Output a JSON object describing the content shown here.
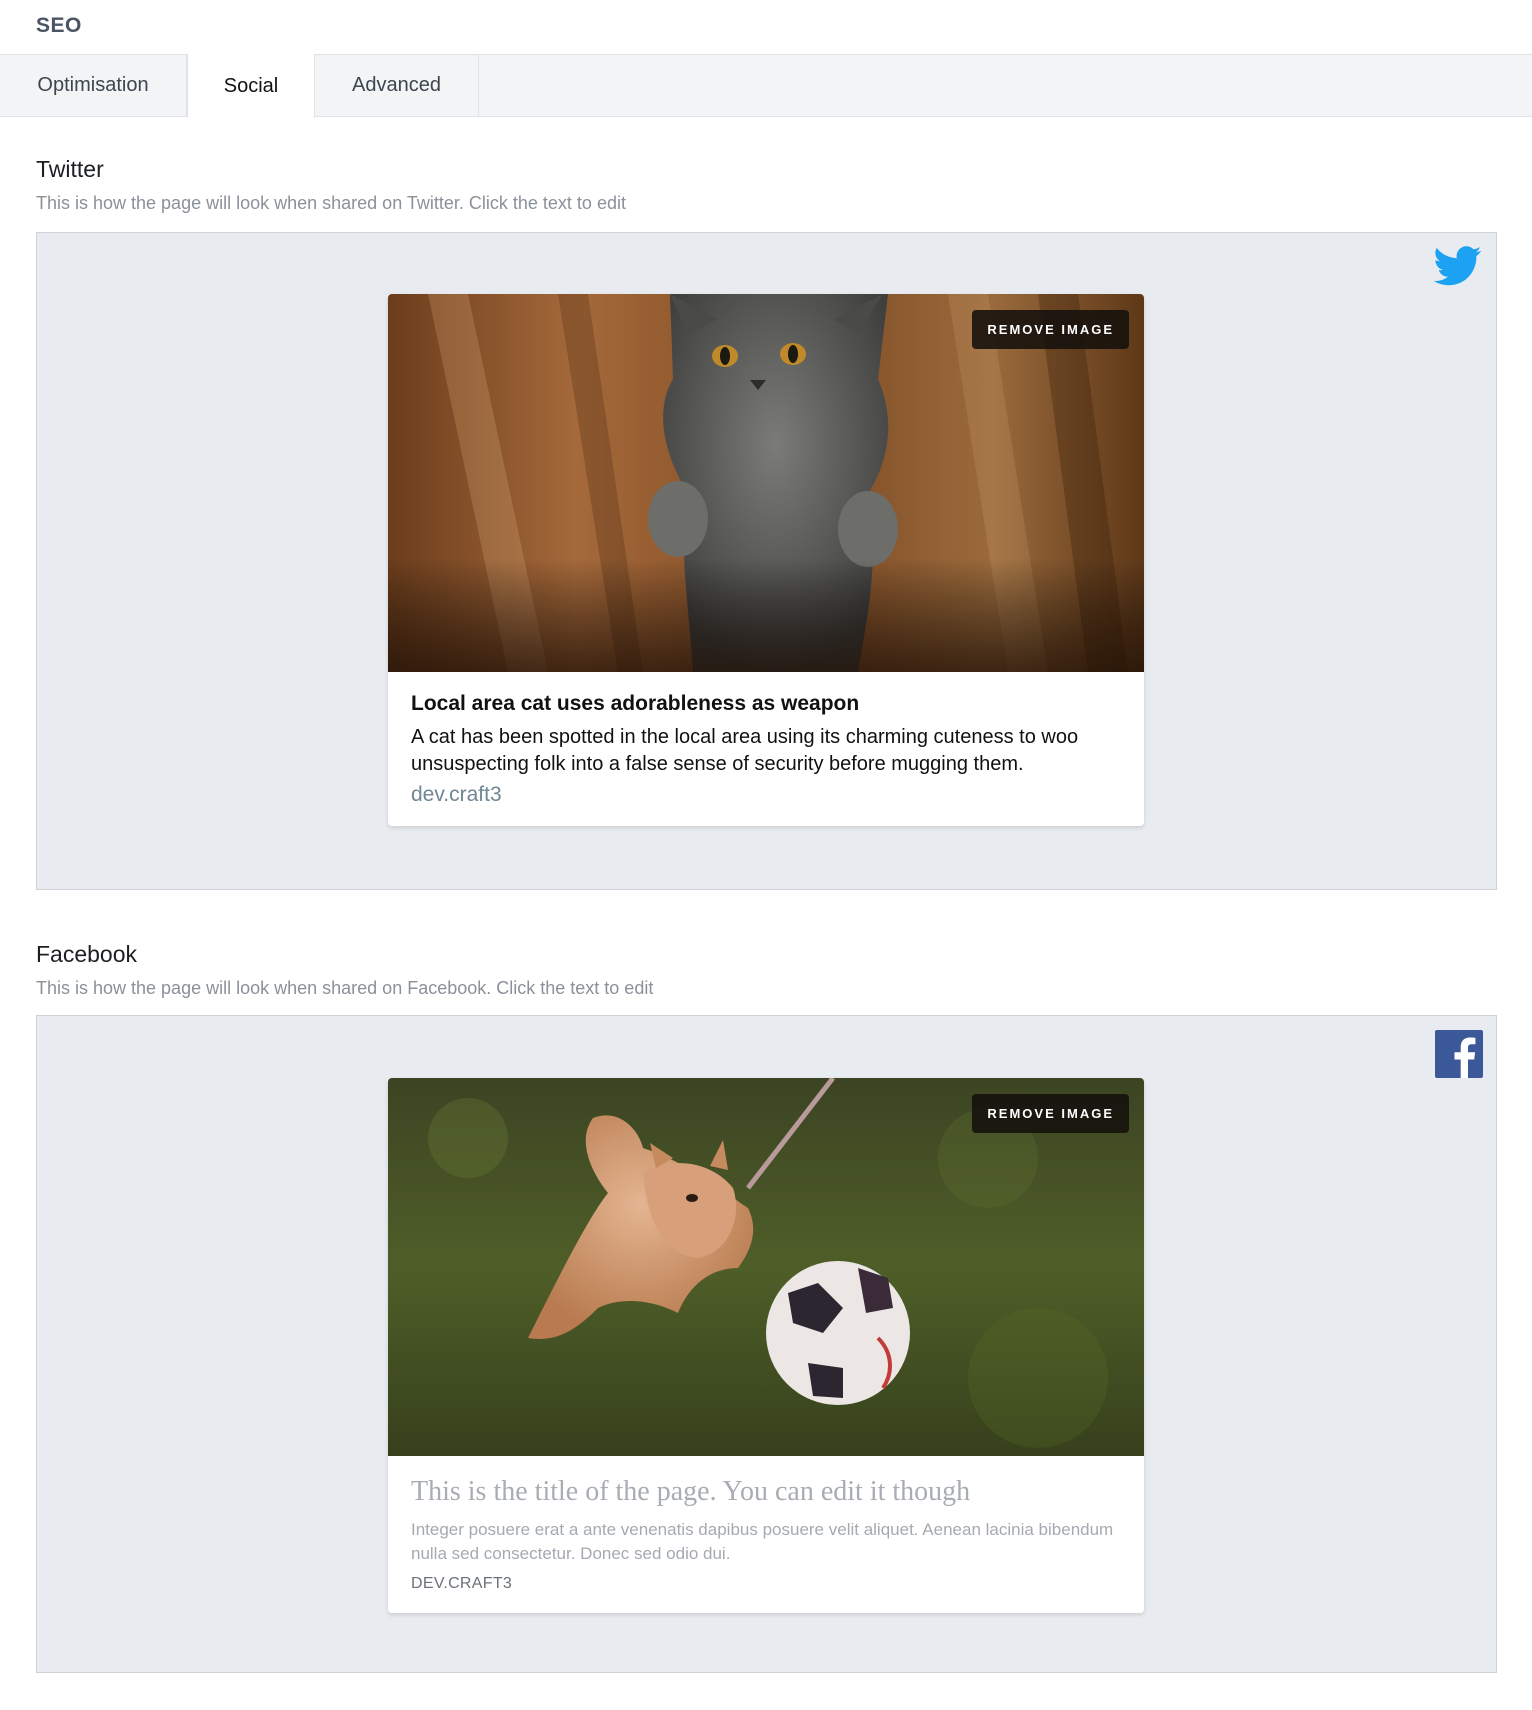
{
  "field": {
    "label": "SEO"
  },
  "tabs": [
    {
      "label": "Optimisation",
      "active": false
    },
    {
      "label": "Social",
      "active": true
    },
    {
      "label": "Advanced",
      "active": false
    }
  ],
  "twitter": {
    "heading": "Twitter",
    "description": "This is how the page will look when shared on Twitter. Click the text to edit",
    "icon": "twitter-bird-icon",
    "icon_color": "#1da1f2",
    "card": {
      "remove_label": "REMOVE IMAGE",
      "title": "Local area cat uses adorableness as weapon",
      "description": "A cat has been spotted in the local area using its charming cuteness to woo unsuspecting folk into a false sense of security before mugging them.",
      "domain": "dev.craft3"
    }
  },
  "facebook": {
    "heading": "Facebook",
    "description": "This is how the page will look when shared on Facebook. Click the text to edit",
    "icon": "facebook-logo-icon",
    "icon_color": "#3b5998",
    "card": {
      "remove_label": "REMOVE IMAGE",
      "title": "This is the title of the page. You can edit it though",
      "description": "Integer posuere erat a ante venenatis dapibus posuere velit aliquet. Aenean lacinia bibendum nulla sed consectetur. Donec sed odio dui.",
      "domain": "DEV.CRAFT3"
    }
  }
}
